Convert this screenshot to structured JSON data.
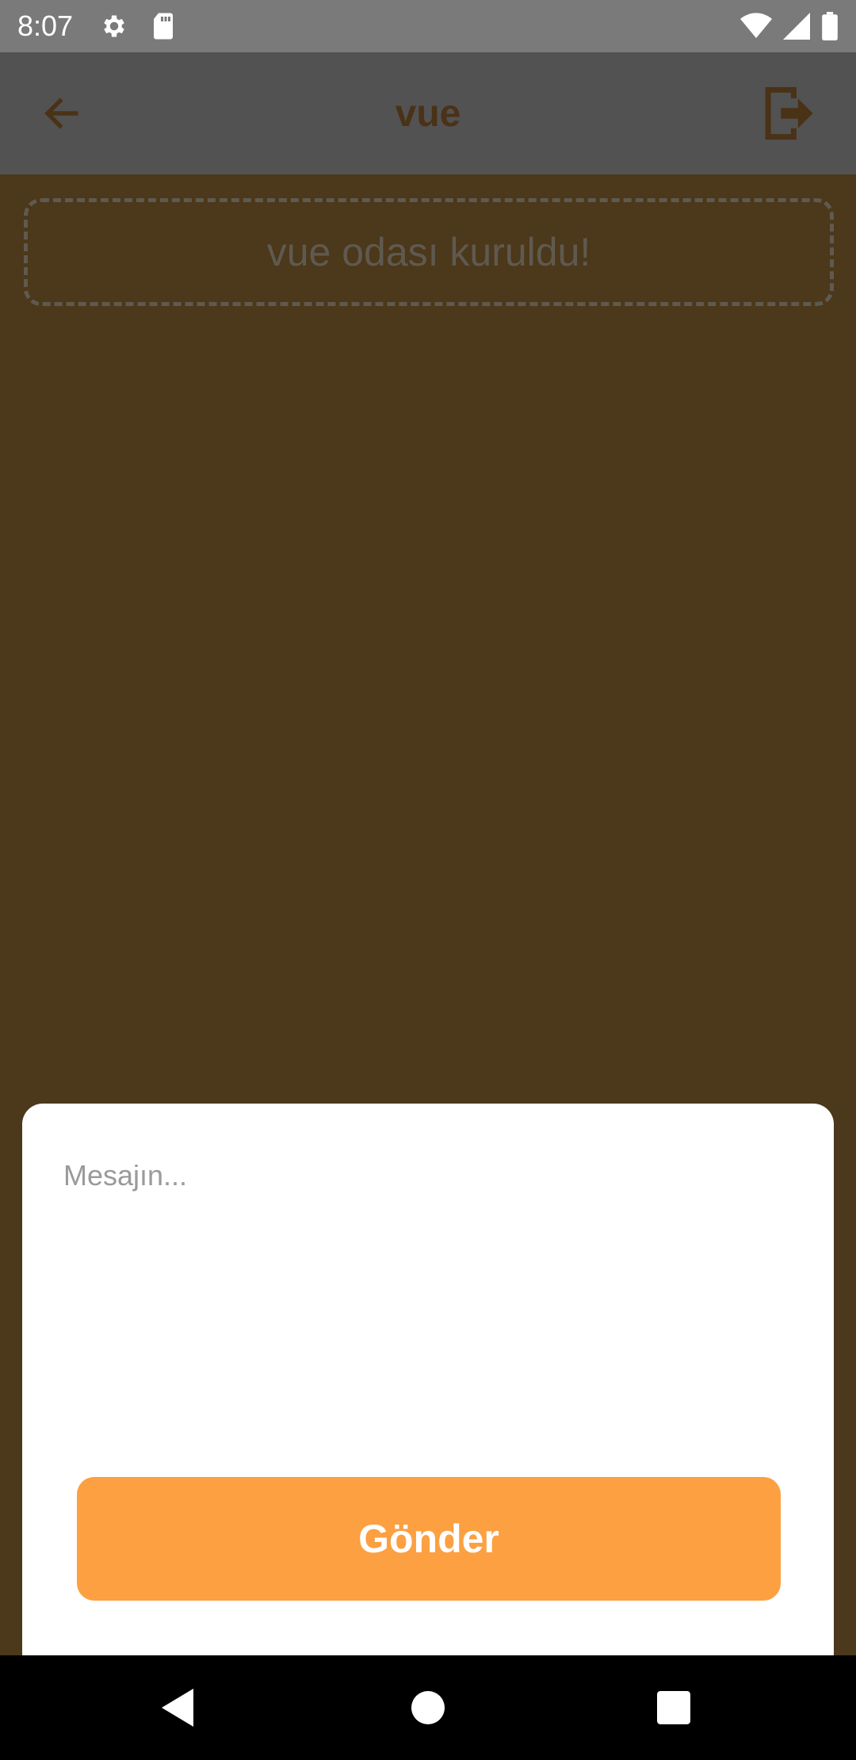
{
  "status_bar": {
    "time": "8:07",
    "icons": [
      "settings-icon",
      "sd-card-icon",
      "wifi-icon",
      "signal-icon",
      "battery-icon"
    ]
  },
  "app_bar": {
    "title": "vue",
    "back_icon": "arrow-left-icon",
    "exit_icon": "logout-icon"
  },
  "chat": {
    "system_message": "vue odası kuruldu!"
  },
  "composer": {
    "placeholder": "Mesajın...",
    "value": "",
    "send_label": "Gönder"
  },
  "nav_bar": {
    "icons": [
      "back-triangle-icon",
      "home-circle-icon",
      "recents-square-icon"
    ]
  },
  "colors": {
    "background_overlay": "#4C381A",
    "app_bar_dimmed": "#525252",
    "accent": "#FCA041",
    "status_bar": "#7A7A7A"
  }
}
